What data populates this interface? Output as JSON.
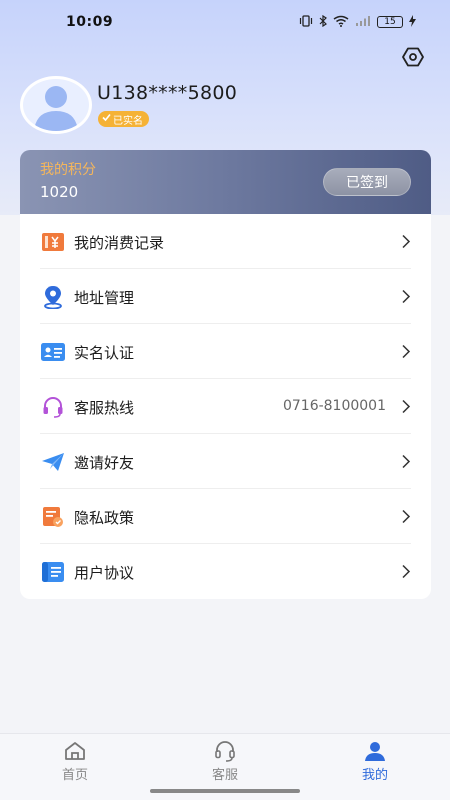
{
  "status_bar": {
    "time": "10:09",
    "battery": "15"
  },
  "profile": {
    "username": "U138****5800",
    "verified_label": "已实名"
  },
  "points": {
    "label": "我的积分",
    "value": "1020",
    "signin_label": "已签到"
  },
  "menu": {
    "items": [
      {
        "label": "我的消费记录",
        "icon": "receipt-icon",
        "value": ""
      },
      {
        "label": "地址管理",
        "icon": "location-pin-icon",
        "value": ""
      },
      {
        "label": "实名认证",
        "icon": "id-card-icon",
        "value": ""
      },
      {
        "label": "客服热线",
        "icon": "headset-icon",
        "value": "0716-8100001"
      },
      {
        "label": "邀请好友",
        "icon": "paper-plane-icon",
        "value": ""
      },
      {
        "label": "隐私政策",
        "icon": "document-icon",
        "value": ""
      },
      {
        "label": "用户协议",
        "icon": "agreement-icon",
        "value": ""
      }
    ]
  },
  "tabs": [
    {
      "label": "首页",
      "icon": "home-icon",
      "active": false
    },
    {
      "label": "客服",
      "icon": "headset-icon",
      "active": false
    },
    {
      "label": "我的",
      "icon": "person-icon",
      "active": true
    }
  ],
  "colors": {
    "accent": "#2f6bdb",
    "points_label": "#f4b65c",
    "badge": "#f5b236"
  }
}
